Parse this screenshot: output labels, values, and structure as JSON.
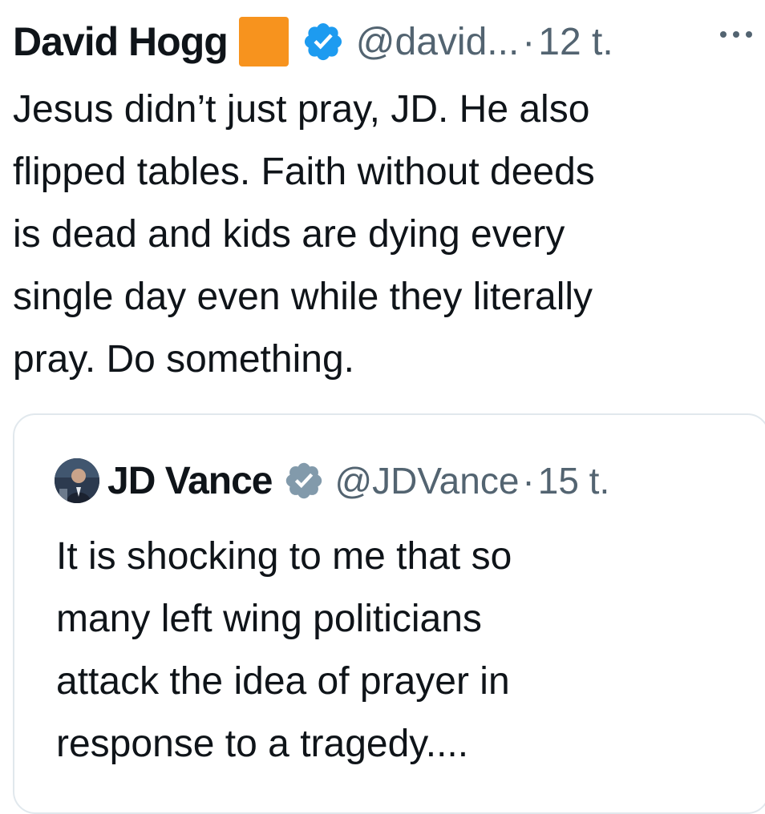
{
  "tweet": {
    "author_name": "David Hogg",
    "handle": "@david...",
    "separator": "·",
    "time": "12 t.",
    "text_lines": [
      "Jesus didn’t just pray, JD. He also",
      "flipped tables. Faith without deeds",
      "is dead and kids are dying every",
      "single day even while they literally",
      "pray. Do something."
    ]
  },
  "quoted_tweet": {
    "author_name": "JD Vance",
    "handle": "@JDVance",
    "separator": "·",
    "time": "15 t.",
    "text_lines": [
      "It is shocking to me that so",
      "many left wing politicians",
      "attack the idea of prayer in",
      "response to a tragedy...."
    ]
  },
  "colors": {
    "emoji_square": "#f7931e",
    "verified_blue": "#1d9bf0",
    "verified_gray": "#829aab",
    "secondary_text": "#536471",
    "border": "#e1e8ed"
  },
  "icons": [
    "orange-square-emoji",
    "verified-badge-icon",
    "more-options-icon",
    "gray-verified-badge-icon"
  ]
}
